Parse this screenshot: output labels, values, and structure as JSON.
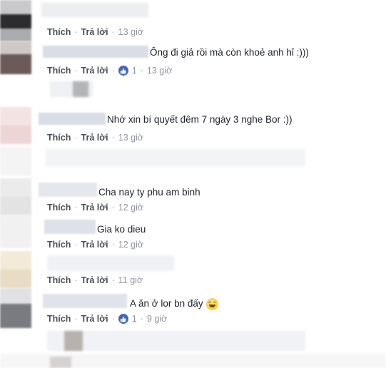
{
  "colors": {
    "link": "#4b4f56",
    "meta": "#90949c",
    "text": "#1d2129",
    "like_badge": "#4267b2"
  },
  "comments": [
    {
      "text": "",
      "actions": {
        "like": "Thích",
        "reply": "Trả lời",
        "time": "13 giờ"
      }
    },
    {
      "text": "Ông đi giả rồi mà còn khoẻ anh hỉ :)))",
      "actions": {
        "like": "Thích",
        "reply": "Trả lời",
        "reactions": "1",
        "time": "13 giờ"
      },
      "reaction_icon": "thumbs-up-icon"
    },
    {
      "text": "Nhớ xin bí quyết đêm 7 ngày 3 nghe Bor :))",
      "actions": {
        "like": "Thích",
        "reply": "Trả lời",
        "time": "13 giờ"
      }
    },
    {
      "text": "Cha nay ty phu am binh",
      "actions": {
        "like": "Thích",
        "reply": "Trả lời",
        "time": "12 giờ"
      }
    },
    {
      "text": "Gia ko dieu",
      "actions": {
        "like": "Thích",
        "reply": "Trả lời",
        "time": "12 giờ"
      }
    },
    {
      "text": "",
      "actions": {
        "like": "Thích",
        "reply": "Trả lời",
        "time": "11 giờ"
      }
    },
    {
      "text": "A ăn ở lor bn đấy",
      "emoji": "grinning-squint-emoji",
      "actions": {
        "like": "Thích",
        "reply": "Trả lời",
        "reactions": "1",
        "time": "9 giờ"
      },
      "reaction_icon": "thumbs-up-icon"
    }
  ],
  "separator": "·"
}
